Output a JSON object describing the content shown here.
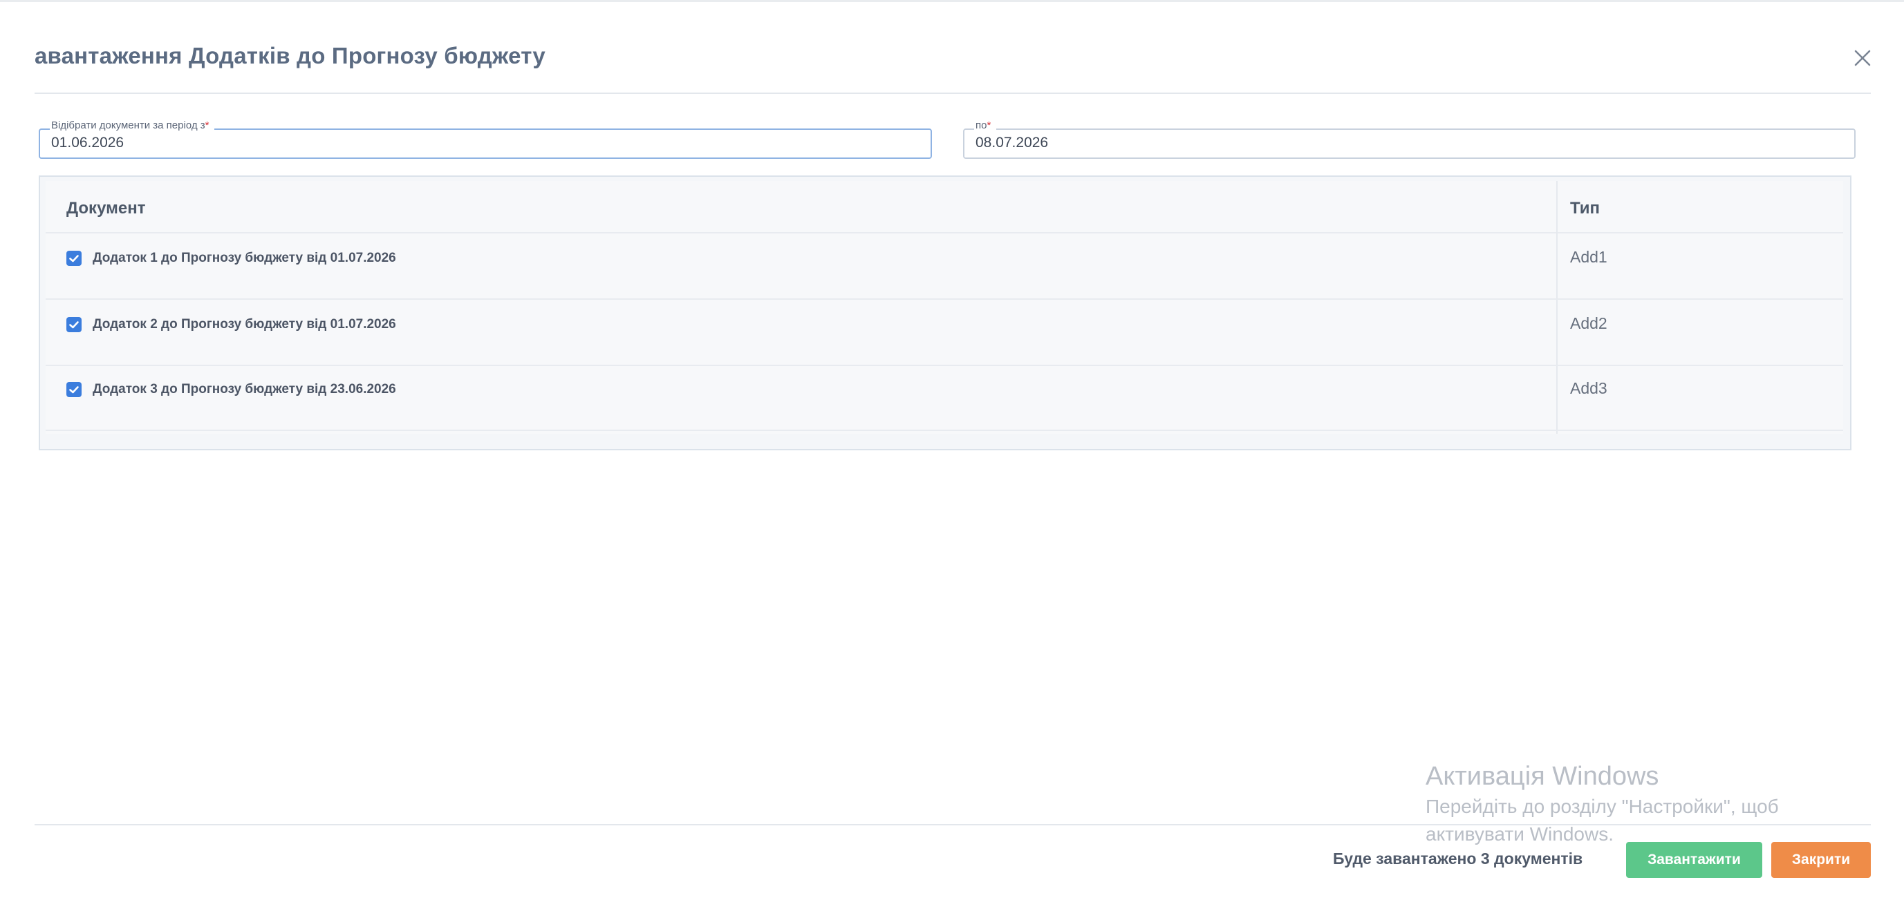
{
  "dialog": {
    "title": "авантаження Додатків до Прогнозу бюджету"
  },
  "filters": {
    "from_label": "Відібрати документи за період з",
    "from_required": "*",
    "from_value": "01.06.2026",
    "to_label": "по",
    "to_required": "*",
    "to_value": "08.07.2026"
  },
  "table": {
    "columns": [
      "Документ",
      "Тип"
    ],
    "rows": [
      {
        "document": "Додаток 1 до Прогнозу бюджету від 01.07.2026",
        "type": "Add1",
        "checked": true
      },
      {
        "document": "Додаток 2 до Прогнозу бюджету від 01.07.2026",
        "type": "Add2",
        "checked": true
      },
      {
        "document": "Додаток 3 до Прогнозу бюджету від 23.06.2026",
        "type": "Add3",
        "checked": true
      }
    ]
  },
  "watermark": {
    "line1": "Активація Windows",
    "line2": "Перейдіть до розділу \"Настройки\", щоб",
    "line3": "активувати Windows."
  },
  "footer": {
    "summary_prefix": "Буде завантажено",
    "summary_count": "3",
    "summary_suffix": "документів",
    "load_label": "Завантажити",
    "close_label": "Закрити"
  },
  "colors": {
    "checkbox": "#3b7ddd",
    "load_button": "#5cc78a",
    "close_button": "#ef8c48",
    "required_mark": "#d9343a"
  },
  "icons": {
    "close": "close-icon",
    "checkbox": "checkmark-icon"
  }
}
